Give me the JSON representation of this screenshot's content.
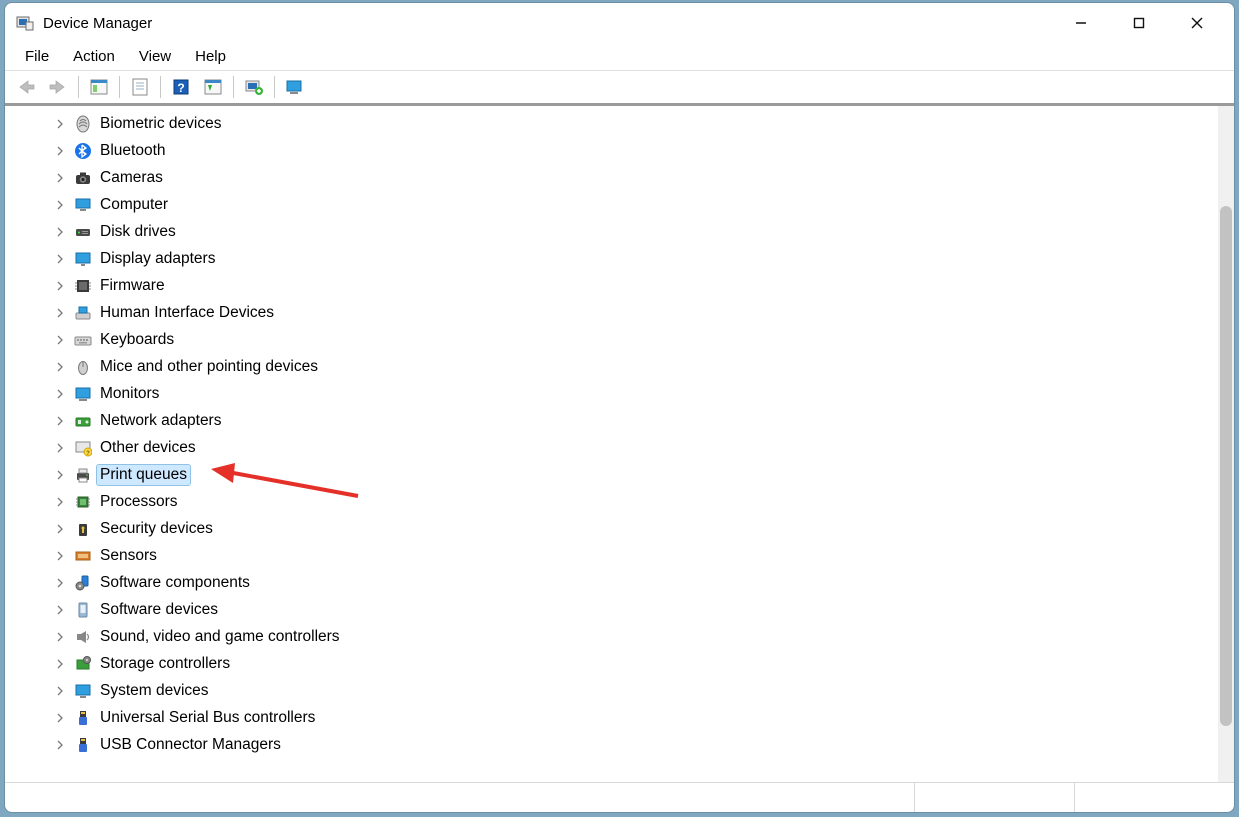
{
  "window": {
    "title": "Device Manager"
  },
  "menu": {
    "file": "File",
    "action": "Action",
    "view": "View",
    "help": "Help"
  },
  "tree": {
    "items": [
      {
        "label": "Biometric devices",
        "icon": "biometric",
        "selected": false
      },
      {
        "label": "Bluetooth",
        "icon": "bluetooth",
        "selected": false
      },
      {
        "label": "Cameras",
        "icon": "camera",
        "selected": false
      },
      {
        "label": "Computer",
        "icon": "computer",
        "selected": false
      },
      {
        "label": "Disk drives",
        "icon": "disk",
        "selected": false
      },
      {
        "label": "Display adapters",
        "icon": "display",
        "selected": false
      },
      {
        "label": "Firmware",
        "icon": "firmware",
        "selected": false
      },
      {
        "label": "Human Interface Devices",
        "icon": "hid",
        "selected": false
      },
      {
        "label": "Keyboards",
        "icon": "keyboard",
        "selected": false
      },
      {
        "label": "Mice and other pointing devices",
        "icon": "mouse",
        "selected": false
      },
      {
        "label": "Monitors",
        "icon": "monitor",
        "selected": false
      },
      {
        "label": "Network adapters",
        "icon": "network",
        "selected": false
      },
      {
        "label": "Other devices",
        "icon": "other",
        "selected": false
      },
      {
        "label": "Print queues",
        "icon": "printer",
        "selected": true
      },
      {
        "label": "Processors",
        "icon": "processor",
        "selected": false
      },
      {
        "label": "Security devices",
        "icon": "security",
        "selected": false
      },
      {
        "label": "Sensors",
        "icon": "sensor",
        "selected": false
      },
      {
        "label": "Software components",
        "icon": "swcomp",
        "selected": false
      },
      {
        "label": "Software devices",
        "icon": "swdev",
        "selected": false
      },
      {
        "label": "Sound, video and game controllers",
        "icon": "sound",
        "selected": false
      },
      {
        "label": "Storage controllers",
        "icon": "storage",
        "selected": false
      },
      {
        "label": "System devices",
        "icon": "system",
        "selected": false
      },
      {
        "label": "Universal Serial Bus controllers",
        "icon": "usb",
        "selected": false
      },
      {
        "label": "USB Connector Managers",
        "icon": "usb",
        "selected": false
      }
    ]
  }
}
